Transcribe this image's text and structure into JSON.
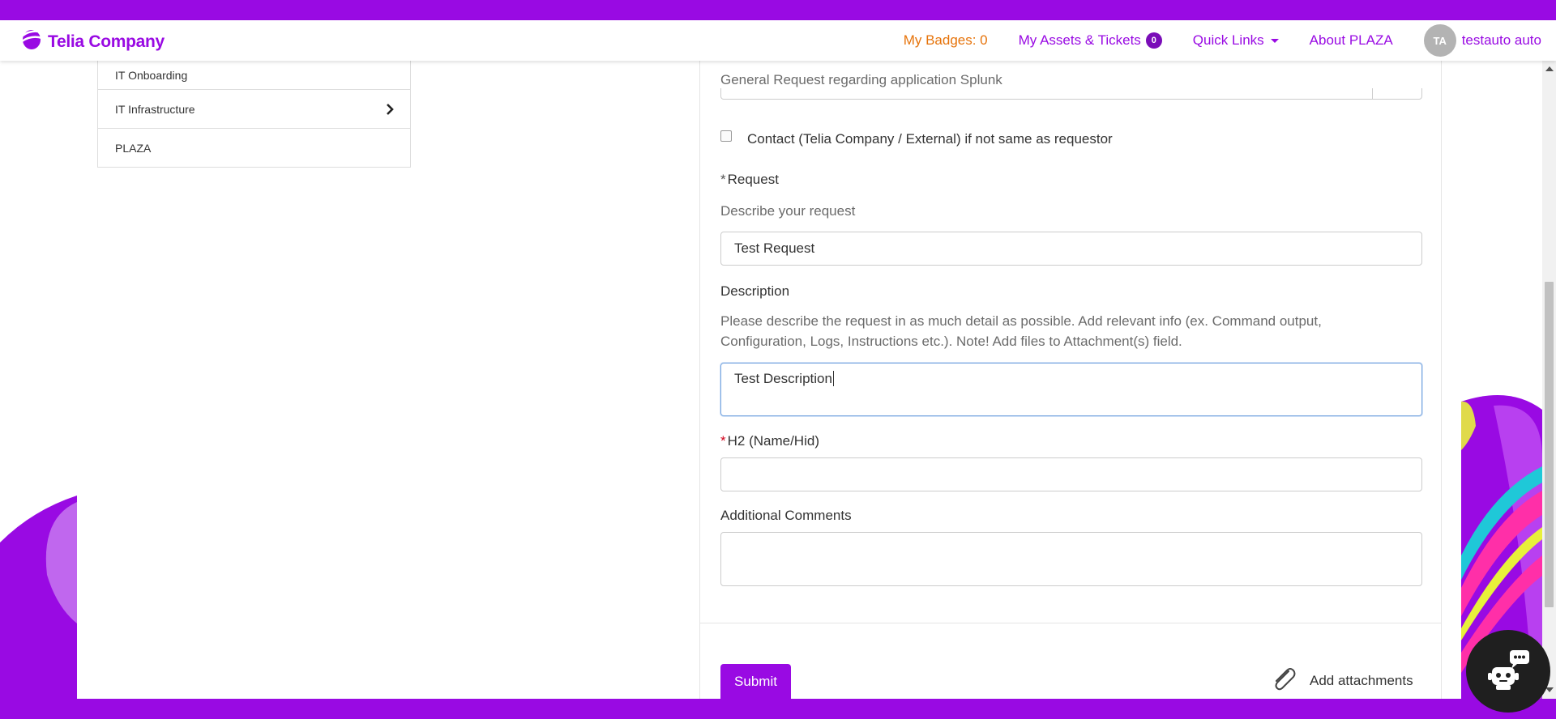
{
  "header": {
    "brand": "Telia Company",
    "nav": {
      "badges": "My Badges: 0",
      "assets": "My Assets & Tickets",
      "assets_count": "0",
      "quick_links": "Quick Links",
      "about": "About PLAZA"
    },
    "user": {
      "initials": "TA",
      "name": "testauto auto"
    }
  },
  "sidebar": {
    "items": [
      {
        "label": "IT Onboarding"
      },
      {
        "label": "IT Infrastructure"
      },
      {
        "label": "PLAZA"
      }
    ]
  },
  "form": {
    "category_help": "General Request regarding application Splunk",
    "contact_checkbox_label": "Contact (Telia Company / External) if not same as requestor",
    "contact_checked": false,
    "request": {
      "star": "*",
      "label": "Request",
      "help": "Describe your request",
      "value": "Test Request"
    },
    "description": {
      "label": "Description",
      "help_line1": "Please describe the request in as much detail as possible. Add relevant info (ex. Command output,",
      "help_line2": "Configuration, Logs, Instructions etc.). Note! Add files to Attachment(s) field.",
      "value": "Test Description"
    },
    "h2": {
      "star": "*",
      "label": "H2 (Name/Hid)",
      "value": ""
    },
    "additional_comments": {
      "label": "Additional Comments",
      "value": ""
    },
    "submit_label": "Submit",
    "attach_label": "Add attachments"
  },
  "colors": {
    "brand_purple": "#990ae3",
    "badge_orange": "#e6730a",
    "required_red": "#d0021b"
  },
  "icons": {
    "logo": "telia-logo-icon",
    "chevron": "chevron-right-icon",
    "attach": "paperclip-icon",
    "chatbot": "chatbot-icon"
  }
}
